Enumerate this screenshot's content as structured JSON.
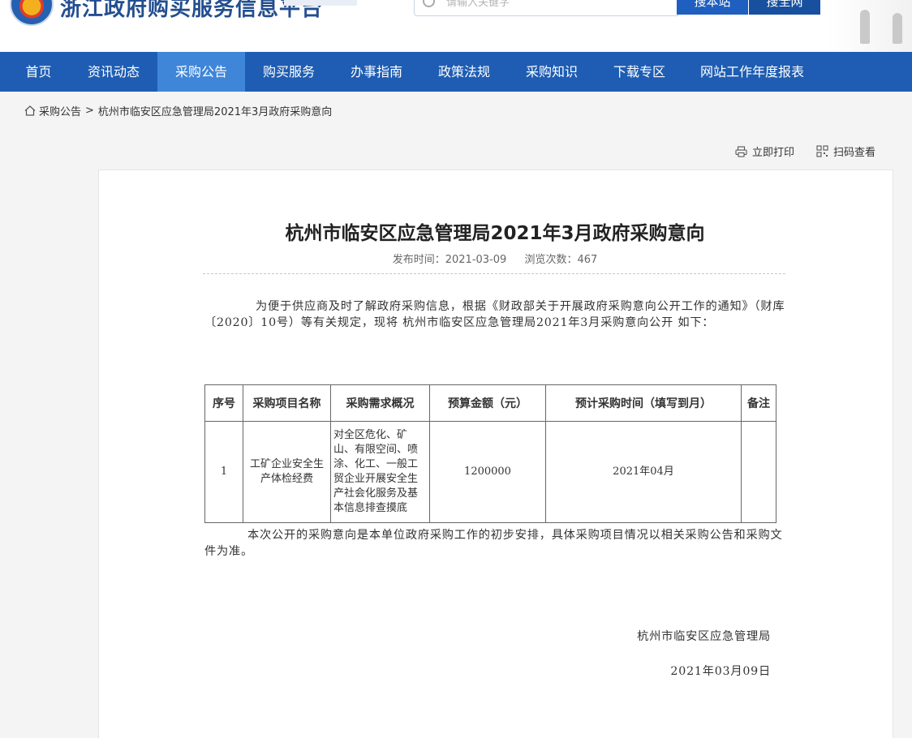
{
  "header": {
    "site_title": "浙江政府购买服务信息平台",
    "search_placeholder": "请输入关键字",
    "search_button": "搜本站",
    "search_button_2": "搜全网"
  },
  "nav": {
    "items": [
      {
        "label": "首页"
      },
      {
        "label": "资讯动态"
      },
      {
        "label": "采购公告"
      },
      {
        "label": "购买服务"
      },
      {
        "label": "办事指南"
      },
      {
        "label": "政策法规"
      },
      {
        "label": "采购知识"
      },
      {
        "label": "下载专区"
      },
      {
        "label": "网站工作年度报表"
      }
    ],
    "active": "采购公告"
  },
  "breadcrumb": {
    "section": "采购公告",
    "separator": ">",
    "current": "杭州市临安区应急管理局2021年3月政府采购意向"
  },
  "tools": {
    "print": "立即打印",
    "scan": "扫码查看"
  },
  "article": {
    "title": "杭州市临安区应急管理局2021年3月政府采购意向",
    "publish_time": "发布时间：2021-03-09",
    "views": "浏览次数：467",
    "intro": "为便于供应商及时了解政府采购信息，根据《财政部关于开展政府采购意向公开工作的通知》（财库〔2020〕10号）等有关规定，现将 杭州市临安区应急管理局2021年3月采购意向公开 如下：",
    "table": {
      "headers": [
        "序号",
        "采购项目名称",
        "采购需求概况",
        "预算金额（元）",
        "预计采购时间（填写到月）",
        "备注"
      ],
      "rows": [
        {
          "no": "1",
          "name": "工矿企业安全生产体检经费",
          "summary": "对全区危化、矿山、有限空间、喷涂、化工、一般工贸企业开展安全生产社会化服务及基本信息排查摸底",
          "budget": "1200000",
          "time": "2021年04月",
          "remark": ""
        }
      ]
    },
    "closing": "本次公开的采购意向是本单位政府采购工作的初步安排，具体采购项目情况以相关采购公告和采购文件为准。",
    "signature": "杭州市临安区应急管理局",
    "date": "2021年03月09日"
  }
}
